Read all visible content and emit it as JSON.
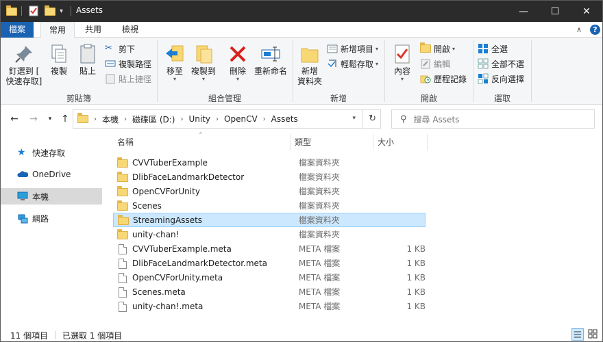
{
  "window": {
    "title": "Assets",
    "controls": {
      "minimize": "—",
      "maximize": "☐",
      "close": "✕"
    }
  },
  "ribbon_tabs": [
    "檔案",
    "常用",
    "共用",
    "檢視"
  ],
  "ribbon": {
    "clipboard": {
      "label": "剪貼簿",
      "pin": "釘選到 [\n快速存取]",
      "copy": "複製",
      "paste": "貼上",
      "cut": "剪下",
      "copy_path": "複製路徑",
      "paste_shortcut": "貼上捷徑"
    },
    "organize": {
      "label": "組合管理",
      "move_to": "移至",
      "copy_to": "複製到",
      "delete": "刪除",
      "rename": "重新命名"
    },
    "new": {
      "label": "新增",
      "new_folder": "新增\n資料夾",
      "new_item": "新增項目",
      "easy_access": "輕鬆存取"
    },
    "open": {
      "label": "開啟",
      "properties": "內容",
      "open": "開啟",
      "edit": "編輯",
      "history": "歷程記錄"
    },
    "select": {
      "label": "選取",
      "select_all": "全選",
      "select_none": "全部不選",
      "invert": "反向選擇"
    }
  },
  "address": {
    "crumbs": [
      "本機",
      "磁碟區 (D:)",
      "Unity",
      "OpenCV",
      "Assets"
    ],
    "search_placeholder": "搜尋 Assets"
  },
  "nav_pane": {
    "items": [
      {
        "label": "快速存取",
        "icon": "star-icon"
      },
      {
        "label": "OneDrive",
        "icon": "cloud-icon"
      },
      {
        "label": "本機",
        "icon": "computer-icon",
        "selected": true
      },
      {
        "label": "網路",
        "icon": "network-icon"
      }
    ]
  },
  "columns": {
    "name": "名稱",
    "type": "類型",
    "size": "大小"
  },
  "files": [
    {
      "name": "CVVTuberExample",
      "type": "檔案資料夾",
      "size": "",
      "kind": "folder"
    },
    {
      "name": "DlibFaceLandmarkDetector",
      "type": "檔案資料夾",
      "size": "",
      "kind": "folder"
    },
    {
      "name": "OpenCVForUnity",
      "type": "檔案資料夾",
      "size": "",
      "kind": "folder"
    },
    {
      "name": "Scenes",
      "type": "檔案資料夾",
      "size": "",
      "kind": "folder"
    },
    {
      "name": "StreamingAssets",
      "type": "檔案資料夾",
      "size": "",
      "kind": "folder",
      "selected": true
    },
    {
      "name": "unity-chan!",
      "type": "檔案資料夾",
      "size": "",
      "kind": "folder"
    },
    {
      "name": "CVVTuberExample.meta",
      "type": "META 檔案",
      "size": "1 KB",
      "kind": "file"
    },
    {
      "name": "DlibFaceLandmarkDetector.meta",
      "type": "META 檔案",
      "size": "1 KB",
      "kind": "file"
    },
    {
      "name": "OpenCVForUnity.meta",
      "type": "META 檔案",
      "size": "1 KB",
      "kind": "file"
    },
    {
      "name": "Scenes.meta",
      "type": "META 檔案",
      "size": "1 KB",
      "kind": "file"
    },
    {
      "name": "unity-chan!.meta",
      "type": "META 檔案",
      "size": "1 KB",
      "kind": "file"
    }
  ],
  "status": {
    "item_count": "11 個項目",
    "selected": "已選取 1 個項目"
  },
  "colors": {
    "titlebar": "#2b2b2b",
    "file_tab": "#1a63b3",
    "selection": "#cce8ff",
    "folder": "#f8d775"
  }
}
